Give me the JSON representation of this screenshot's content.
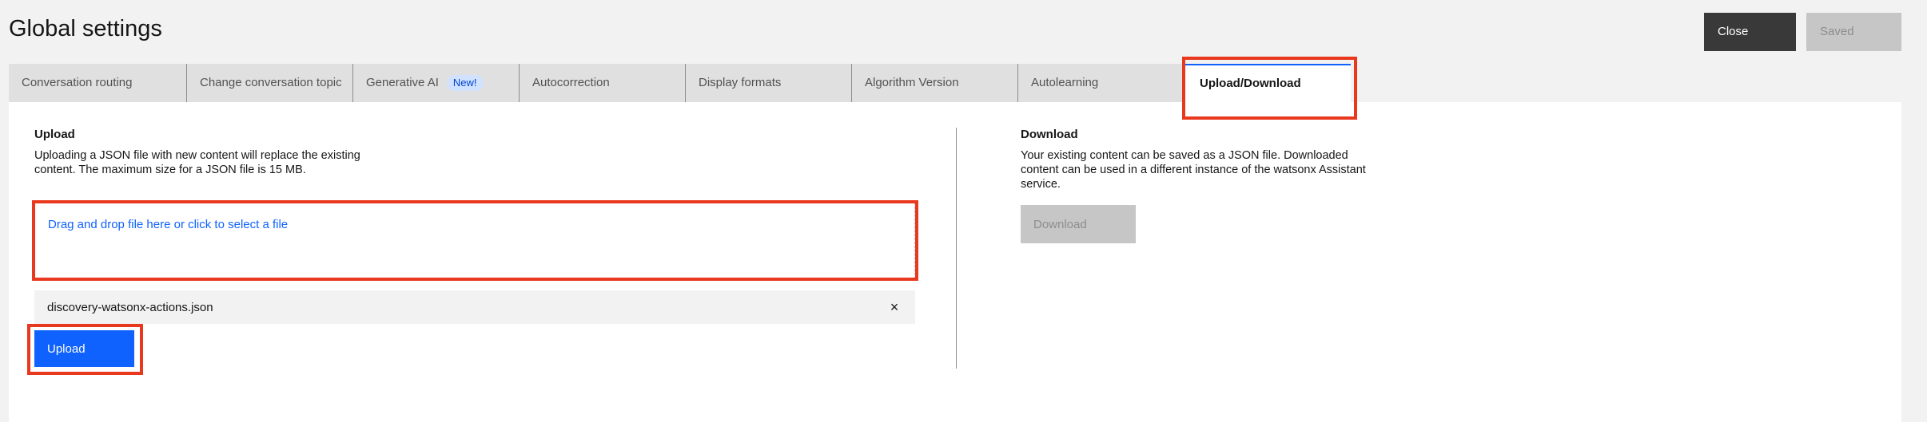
{
  "header": {
    "title": "Global settings",
    "close_label": "Close",
    "saved_label": "Saved"
  },
  "tabs": [
    {
      "label": "Conversation routing"
    },
    {
      "label": "Change conversation topic"
    },
    {
      "label": "Generative AI",
      "badge": "New!"
    },
    {
      "label": "Autocorrection"
    },
    {
      "label": "Display formats"
    },
    {
      "label": "Algorithm Version"
    },
    {
      "label": "Autolearning"
    },
    {
      "label": "Upload/Download",
      "active": true
    }
  ],
  "upload": {
    "title": "Upload",
    "description_line1": "Uploading a JSON file with new content will replace the existing",
    "description_line2": "content. The maximum size for a JSON file is 15 MB.",
    "dropzone_text": "Drag and drop file here or click to select a file",
    "file_name": "discovery-watsonx-actions.json",
    "remove_icon": "×",
    "button_label": "Upload"
  },
  "download": {
    "title": "Download",
    "description_line1": "Your existing content can be saved as a JSON file. Downloaded",
    "description_line2": "content can be used in a different instance of the watsonx Assistant",
    "description_line3": "service.",
    "button_label": "Download"
  },
  "colors": {
    "primary": "#0f62fe",
    "highlight": "#e8391f",
    "dark_button": "#393939",
    "disabled": "#c6c6c6"
  }
}
